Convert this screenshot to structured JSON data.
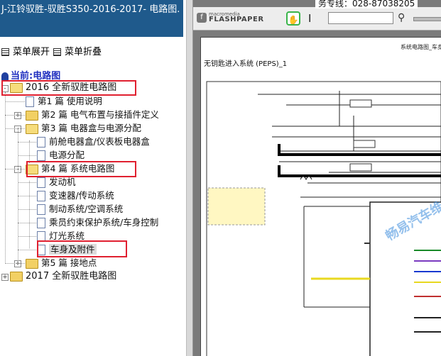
{
  "title": "J-江铃驭胜-驭胜S350-2016-2017- 电路图.",
  "controls": {
    "expand": "菜单展开",
    "collapse": "菜单折叠"
  },
  "current": "当前:电路图",
  "tree": [
    {
      "label": "2016 全新驭胜电路图",
      "level": 0,
      "type": "folder",
      "open": true,
      "pm": "-"
    },
    {
      "label": "第1 篇 使用说明",
      "level": 1,
      "type": "doc"
    },
    {
      "label": "第2 篇 电气布置与接插件定义",
      "level": 1,
      "type": "folder",
      "pm": "+"
    },
    {
      "label": "第3 篇 电器盒与电源分配",
      "level": 1,
      "type": "folder",
      "open": true,
      "pm": "-"
    },
    {
      "label": "前舱电器盒/仪表板电器盒",
      "level": 2,
      "type": "doc"
    },
    {
      "label": "电源分配",
      "level": 2,
      "type": "doc"
    },
    {
      "label": "第4 篇 系统电路图",
      "level": 1,
      "type": "folder",
      "open": true,
      "pm": "-"
    },
    {
      "label": "发动机",
      "level": 2,
      "type": "doc"
    },
    {
      "label": "变速器/传动系统",
      "level": 2,
      "type": "doc"
    },
    {
      "label": "制动系统/空调系统",
      "level": 2,
      "type": "doc"
    },
    {
      "label": "乘员约束保护系统/车身控制",
      "level": 2,
      "type": "doc"
    },
    {
      "label": "灯光系统",
      "level": 2,
      "type": "doc"
    },
    {
      "label": "车身及附件",
      "level": 2,
      "type": "doc",
      "selected": true
    },
    {
      "label": "第5 篇 接地点",
      "level": 1,
      "type": "folder",
      "pm": "+"
    },
    {
      "label": "2017 全新驭胜电路图",
      "level": 0,
      "type": "folder",
      "pm": "+"
    }
  ],
  "viewer": {
    "hotline": "务专线：028-87038205",
    "brand_small": "macromedia",
    "brand_big": "FLASHPAPER",
    "page_header": "系统电路图_车身",
    "page_title": "无钥匙进入系统 (PEPS)_1",
    "watermark": "畅易汽车维"
  },
  "colors": {
    "title_bg": "#1f5a8c",
    "highlight": "#e02030",
    "tool_active": "#39b54a"
  }
}
